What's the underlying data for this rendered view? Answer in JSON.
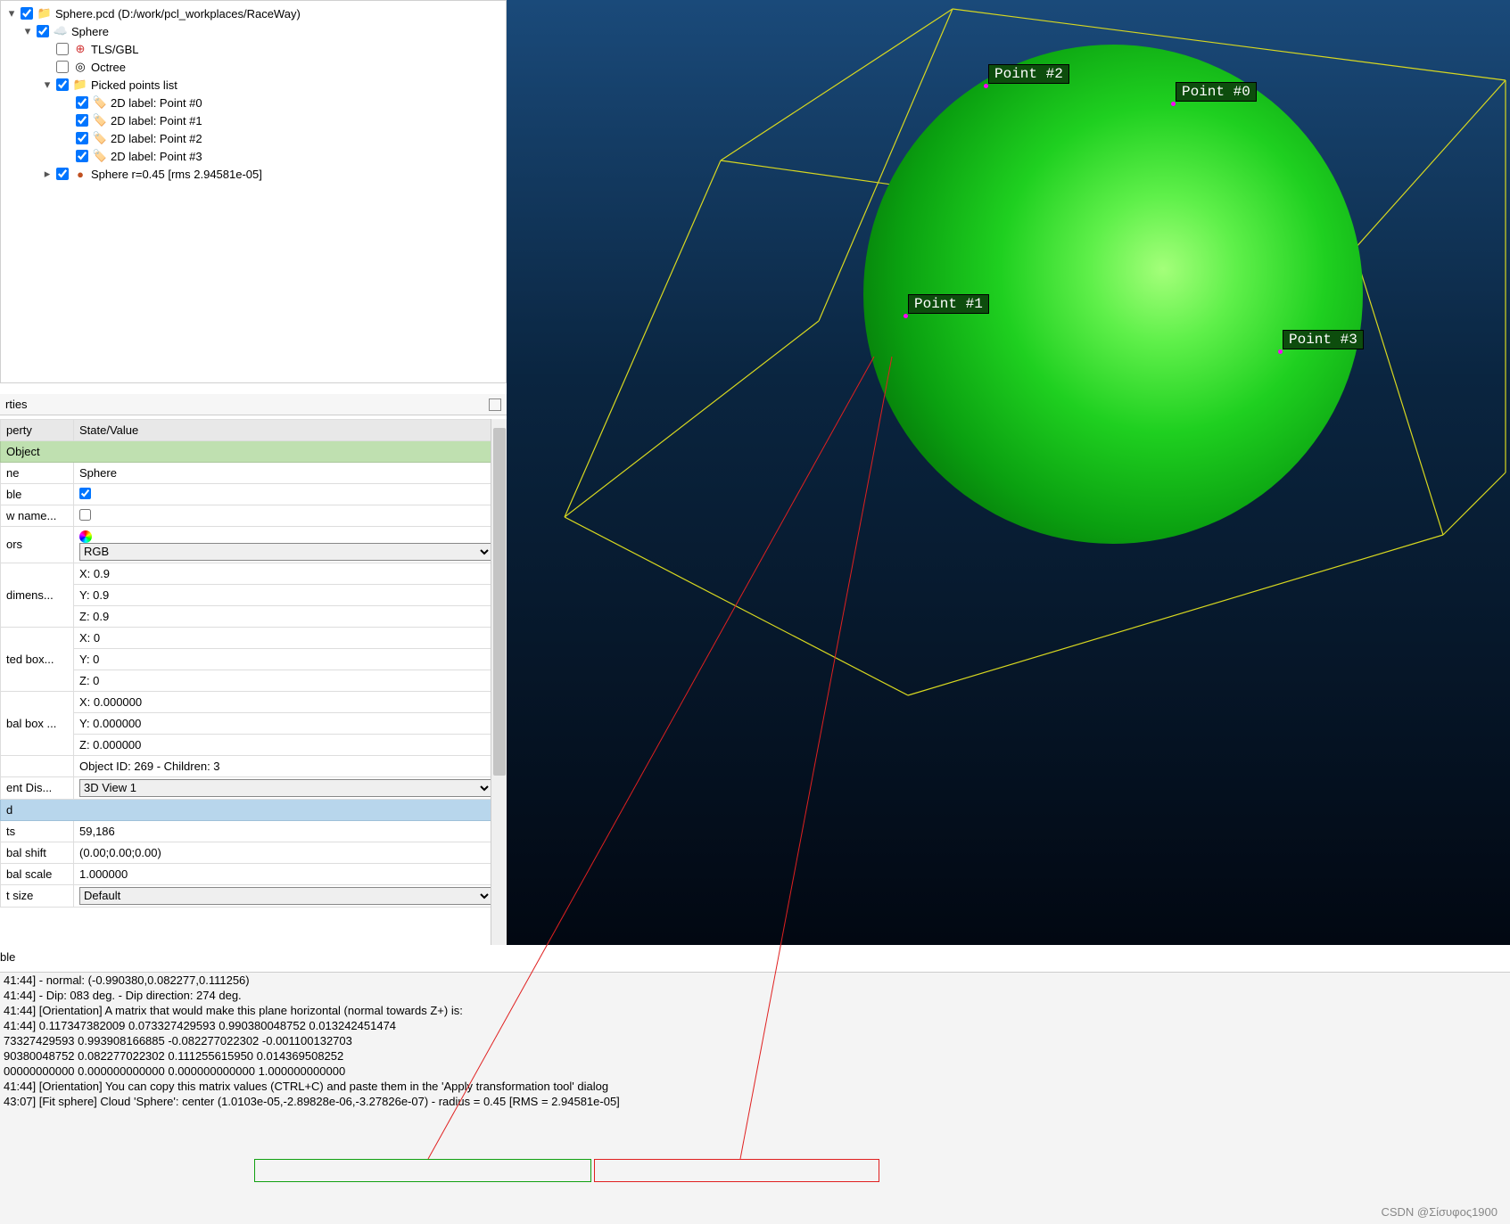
{
  "tree": {
    "root_label": "Sphere.pcd (D:/work/pcl_workplaces/RaceWay)",
    "sphere_label": "Sphere",
    "tls_label": "TLS/GBL",
    "octree_label": "Octree",
    "picked_label": "Picked points list",
    "labels": [
      "2D label: Point #0",
      "2D label: Point #1",
      "2D label: Point #2",
      "2D label: Point #3"
    ],
    "fit_label": "Sphere r=0.45 [rms 2.94581e-05]"
  },
  "props_title": "rties",
  "prop_header": {
    "key": "perty",
    "val": "State/Value"
  },
  "sections": {
    "object": "Object",
    "cloud": "d"
  },
  "props": {
    "name_k": "ne",
    "name_v": "Sphere",
    "visible_k": "ble",
    "showname_k": "w name...",
    "colors_k": "ors",
    "colors_v": "RGB",
    "dim_k": "dimens...",
    "dim_x": "X: 0.9",
    "dim_y": "Y: 0.9",
    "dim_z": "Z: 0.9",
    "sbox_k": "ted box...",
    "sbox_x": "X: 0",
    "sbox_y": "Y: 0",
    "sbox_z": "Z: 0",
    "gbox_k": "bal box ...",
    "gbox_x": "X: 0.000000",
    "gbox_y": "Y: 0.000000",
    "gbox_z": "Z: 0.000000",
    "info_v": "Object ID: 269 - Children: 3",
    "disp_k": "ent Dis...",
    "disp_v": "3D View 1",
    "pts_k": "ts",
    "pts_v": "59,186",
    "shift_k": "bal shift",
    "shift_v": "(0.00;0.00;0.00)",
    "scale_k": "bal scale",
    "scale_v": "1.000000",
    "psize_k": "t size",
    "psize_v": "Default"
  },
  "viewport": {
    "points": {
      "p0": "Point #0",
      "p1": "Point #1",
      "p2": "Point #2",
      "p3": "Point #3"
    }
  },
  "bottom_label": "ble",
  "console_lines": [
    "41:44]            - normal: (-0.990380,0.082277,0.111256)",
    "41:44]            - Dip: 083 deg. - Dip direction: 274 deg.",
    "41:44] [Orientation] A matrix that would make this plane horizontal (normal towards Z+) is:",
    "41:44] 0.117347382009 0.073327429593 0.990380048752 0.013242451474",
    "73327429593 0.993908166885 -0.082277022302 -0.001100132703",
    "90380048752 0.082277022302 0.111255615950 0.014369508252",
    "00000000000 0.000000000000 0.000000000000 1.000000000000",
    "41:44] [Orientation] You can copy this matrix values (CTRL+C) and paste them in the 'Apply transformation tool' dialog",
    "43:07] [Fit sphere] Cloud 'Sphere': center (1.0103e-05,-2.89828e-06,-3.27826e-07) - radius = 0.45 [RMS = 2.94581e-05]"
  ],
  "watermark": "CSDN @Σίσυφος1900"
}
